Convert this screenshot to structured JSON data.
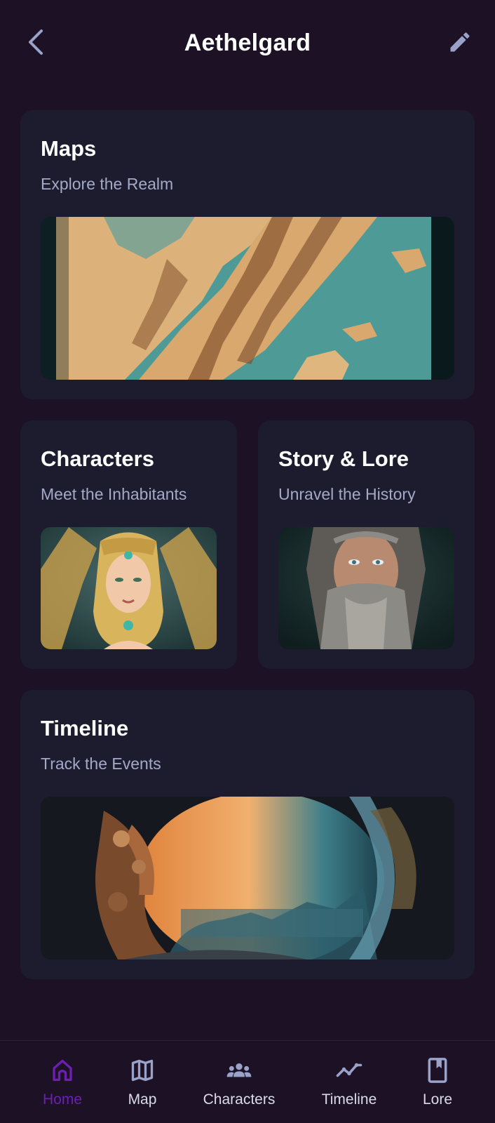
{
  "header": {
    "title": "Aethelgard",
    "back_icon": "chevron-left-icon",
    "edit_icon": "pencil-icon"
  },
  "cards": {
    "maps": {
      "title": "Maps",
      "subtitle": "Explore the Realm"
    },
    "characters": {
      "title": "Characters",
      "subtitle": "Meet the Inhabitants"
    },
    "story": {
      "title": "Story & Lore",
      "subtitle": "Unravel the History"
    },
    "timeline": {
      "title": "Timeline",
      "subtitle": "Track the Events"
    }
  },
  "nav": {
    "items": [
      {
        "label": "Home",
        "icon": "home-icon",
        "active": true
      },
      {
        "label": "Map",
        "icon": "map-icon",
        "active": false
      },
      {
        "label": "Characters",
        "icon": "group-icon",
        "active": false
      },
      {
        "label": "Timeline",
        "icon": "trend-icon",
        "active": false
      },
      {
        "label": "Lore",
        "icon": "book-icon",
        "active": false
      }
    ]
  },
  "colors": {
    "background": "#1d1225",
    "card": "#1c1c2e",
    "subtitle": "#a3a9c7",
    "active_nav": "#6c1fb0",
    "icon": "#9aa2c9"
  }
}
